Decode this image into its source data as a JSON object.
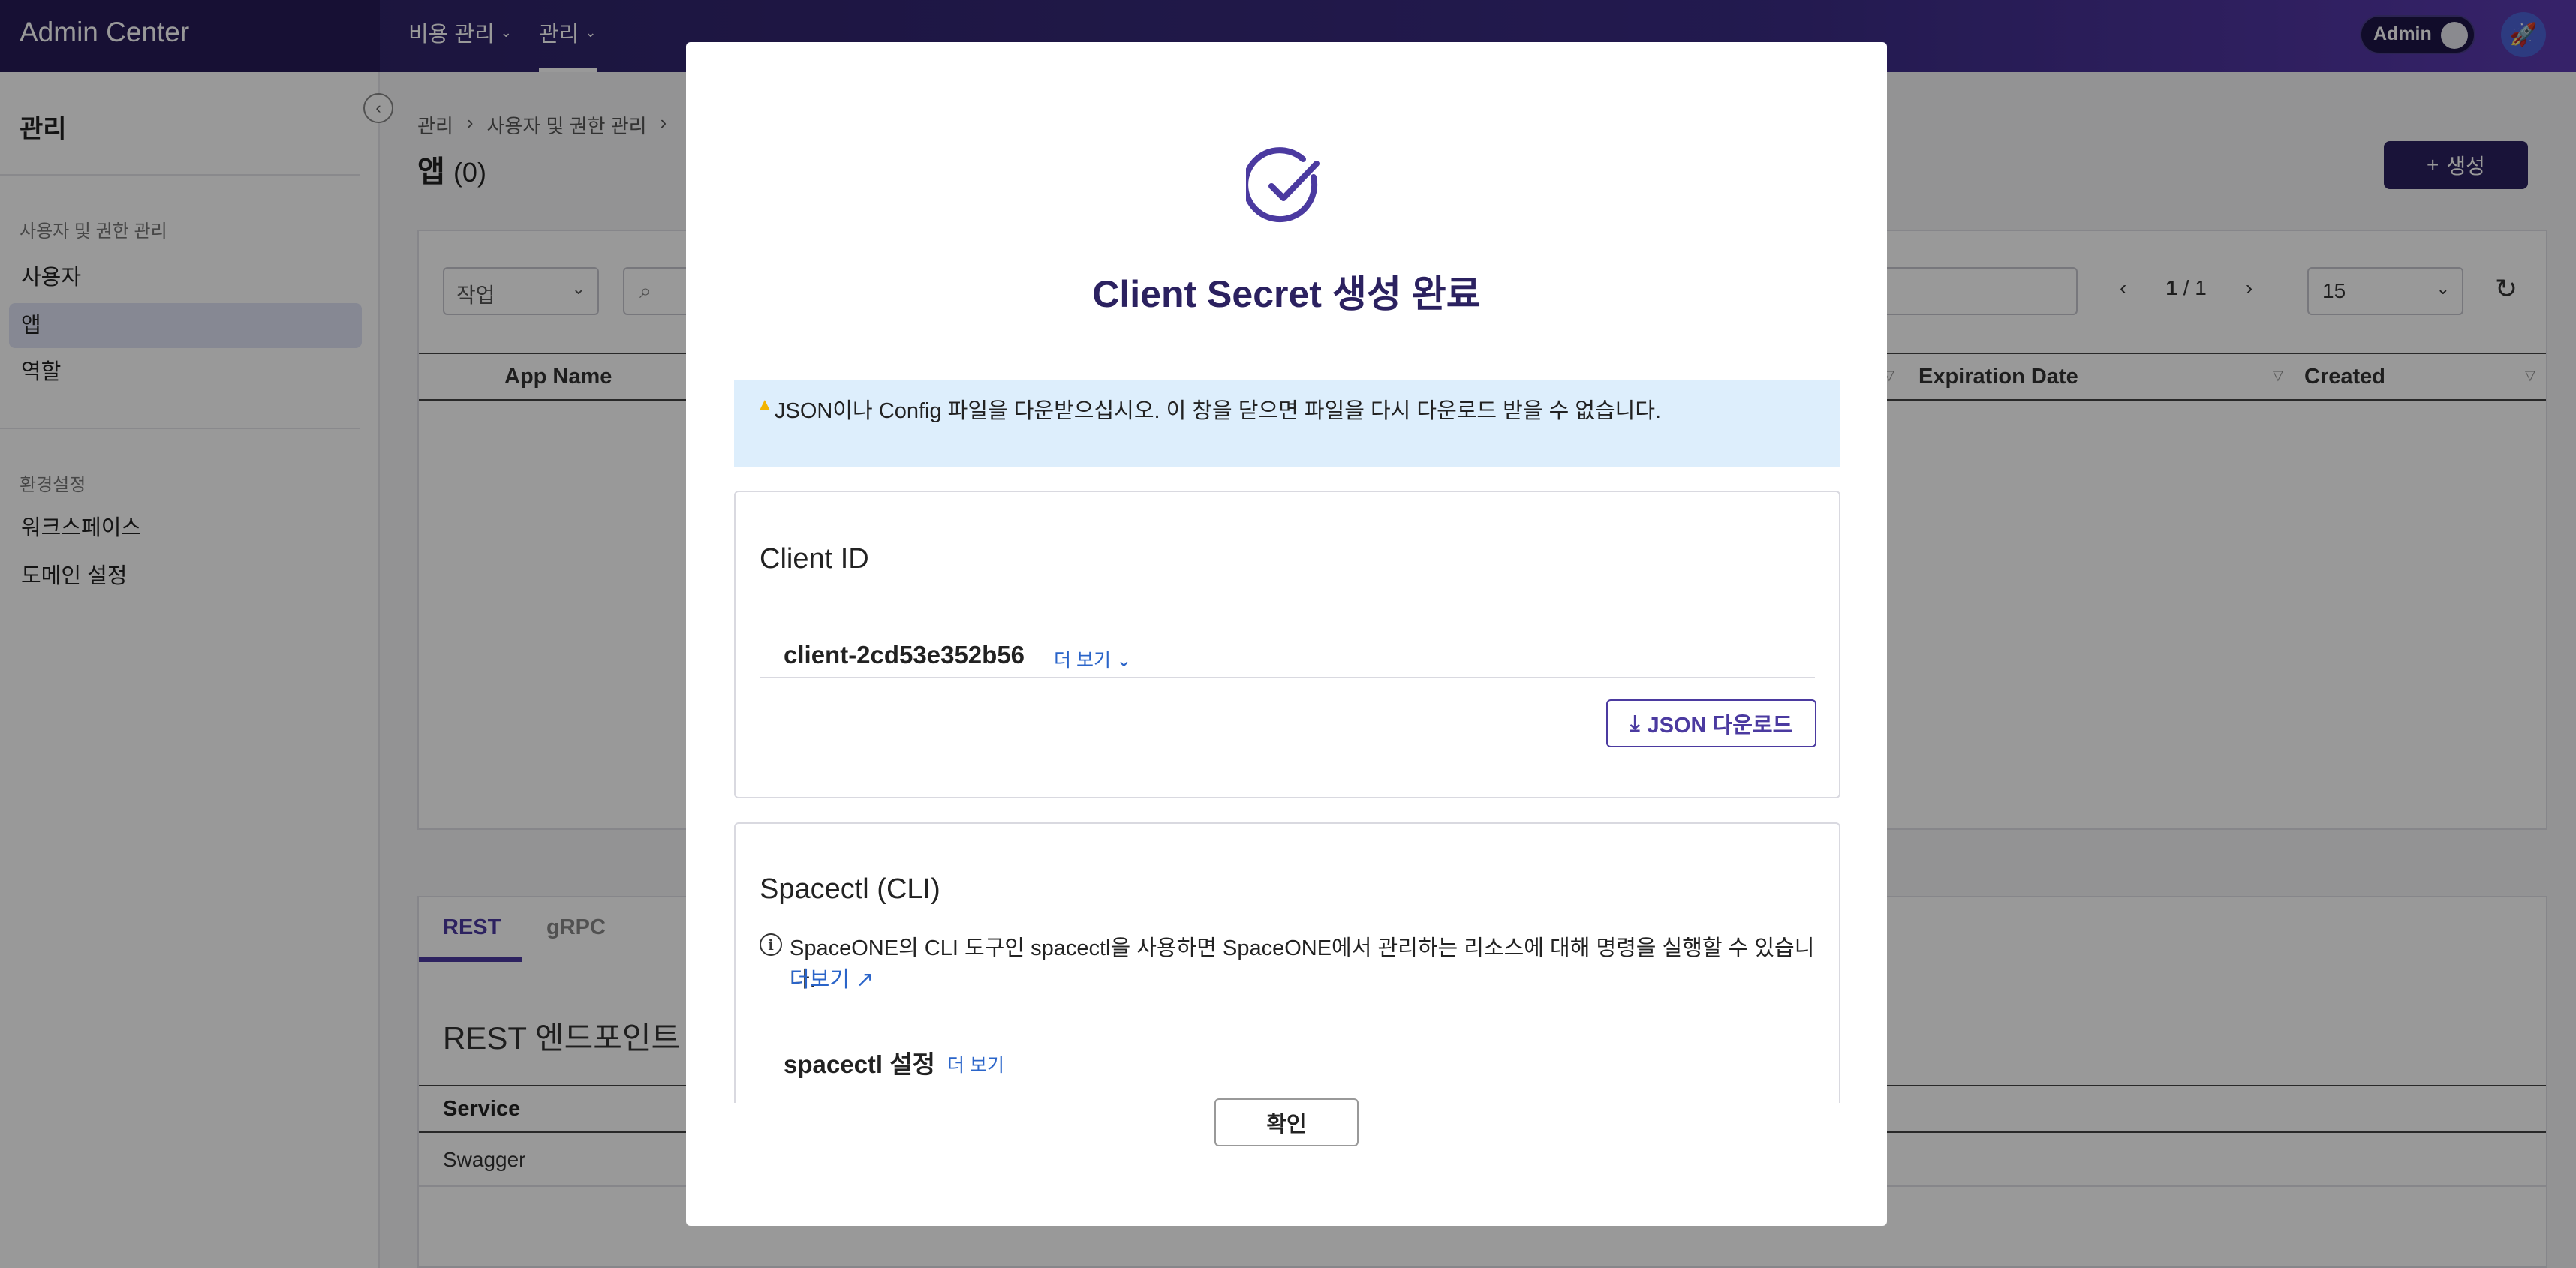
{
  "topbar": {
    "brand": "Admin Center",
    "nav": [
      {
        "label": "비용 관리"
      },
      {
        "label": "관리"
      }
    ],
    "admin_toggle_label": "Admin"
  },
  "sidebar": {
    "title": "관리",
    "group1": "사용자 및 권한 관리",
    "items1": [
      "사용자",
      "앱",
      "역할"
    ],
    "group2": "환경설정",
    "items2": [
      "워크스페이스",
      "도메인 설정"
    ]
  },
  "breadcrumb": [
    "관리",
    "사용자 및 권한 관리"
  ],
  "page": {
    "title": "앱",
    "count": "(0)",
    "create_label": "생성"
  },
  "toolbar": {
    "work_select": "작업",
    "page_current": "1",
    "page_sep": "/ 1",
    "page_size": "15"
  },
  "table": {
    "columns": [
      "App Name",
      "Expiration Date",
      "Created"
    ]
  },
  "tabs": [
    "REST",
    "gRPC"
  ],
  "rest": {
    "title": "REST 엔드포인트",
    "column": "Service",
    "rows": [
      "Swagger"
    ]
  },
  "modal": {
    "title": "Client Secret 생성 완료",
    "notice": "JSON이나 Config 파일을 다운받으십시오. 이 창을 닫으면 파일을 다시 다운로드 받을 수 없습니다.",
    "client_card": {
      "title": "Client ID",
      "client_id": "client-2cd53e352b56",
      "more_label": "더 보기",
      "json_button": "JSON 다운로드"
    },
    "cli_card": {
      "title": "Spacectl (CLI)",
      "description": "SpaceONE의 CLI 도구인 spacectl을 사용하면 SpaceONE에서 관리하는 리소스에 대해 명령을 실행할 수 있습니다.",
      "more_link": "더보기",
      "setting_title": "spacectl 설정",
      "setting_more": "더 보기"
    },
    "confirm": "확인"
  },
  "colors": {
    "primary": "#2b2160",
    "accent": "#4b3aa0",
    "link": "#2a64c9",
    "notice_bg": "#ddeefc"
  }
}
